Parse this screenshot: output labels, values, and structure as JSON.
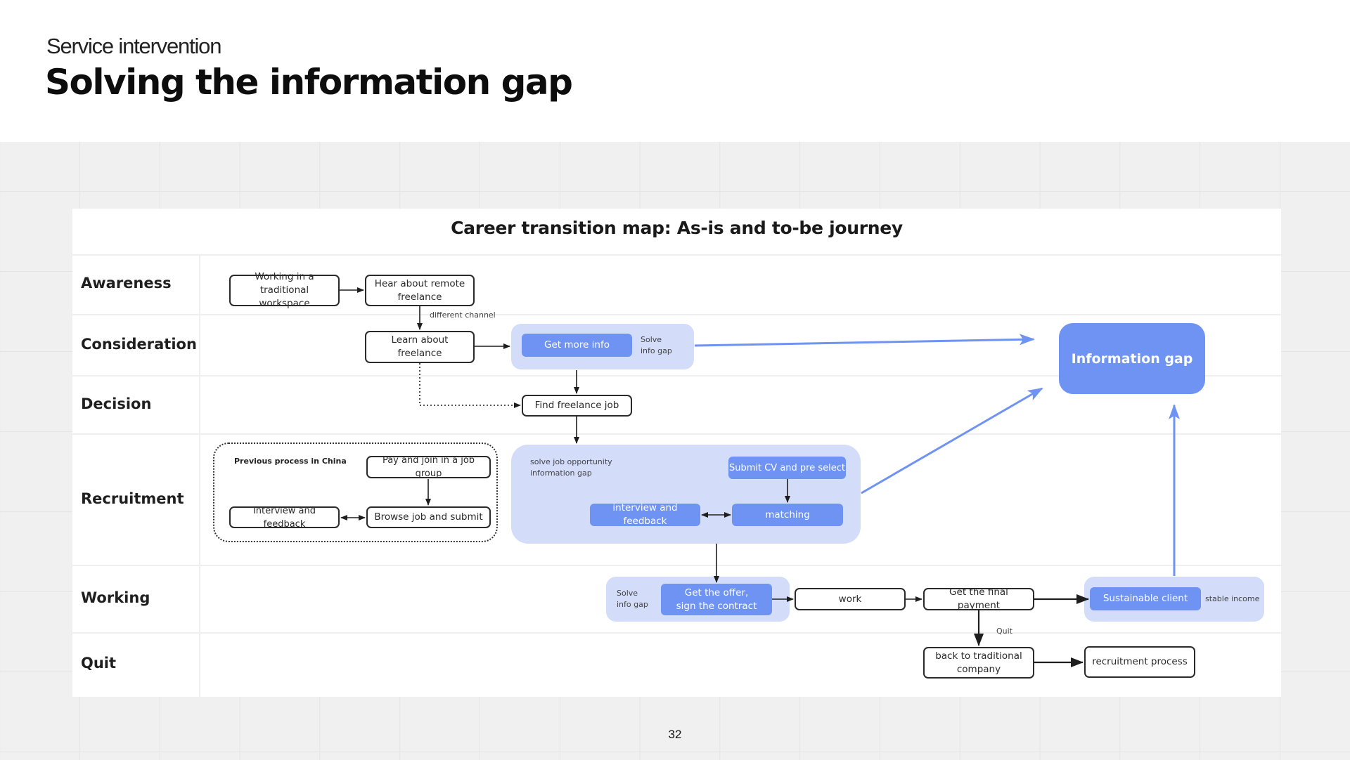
{
  "header": {
    "subtitle": "Service intervention",
    "title": "Solving the information gap"
  },
  "diagram": {
    "title": "Career transition map: As-is and to-be  journey",
    "stages": [
      "Awareness",
      "Consideration",
      "Decision",
      "Recruitment",
      "Working",
      "Quit"
    ],
    "nodes": {
      "working_traditional": "Working in a\ntraditional workspace",
      "hear_remote": "Hear about remote\nfreelance",
      "learn_freelance": "Learn about freelance",
      "get_more_info": "Get more info",
      "find_job": "Find freelance job",
      "information_gap": "Information gap",
      "china_label": "Previous process in China",
      "pay_join_group": "Pay and join in a job group",
      "browse_submit": "Browse job and submit",
      "interview_feedback_old": "Interview and feedback",
      "submit_cv": "Submit CV and pre select",
      "matching": "matching",
      "interview_feedback_new": "interview and feedback",
      "get_offer": "Get the offer,\nsign the contract",
      "work": "work",
      "final_payment": "Get the final payment",
      "sustainable_client": "Sustainable client",
      "back_traditional": "back to traditional\ncompany",
      "recruitment_process": "recruitment process"
    },
    "notes": {
      "different_channel": "different channel",
      "solve_info_gap_1": "Solve\ninfo gap",
      "solve_job_gap": "solve job opportunity\ninformation gap",
      "solve_info_gap_2": "Solve\ninfo gap",
      "stable_income": "stable income",
      "quit": "Quit"
    },
    "colors": {
      "accent_blue": "#6f93f2",
      "group_fill": "#d3ddf9",
      "outline": "#2a2a2a"
    }
  },
  "footer": {
    "page_number": "32"
  }
}
